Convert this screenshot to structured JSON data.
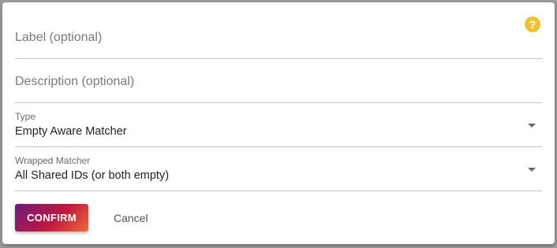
{
  "dialog": {
    "help_icon": "?",
    "label_field": {
      "placeholder": "Label (optional)",
      "value": ""
    },
    "description_field": {
      "placeholder": "Description (optional)",
      "value": ""
    },
    "type_select": {
      "label": "Type",
      "value": "Empty Aware Matcher"
    },
    "wrapped_select": {
      "label": "Wrapped Matcher",
      "value": "All Shared IDs (or both empty)"
    },
    "confirm_label": "CONFIRM",
    "cancel_label": "Cancel"
  },
  "colors": {
    "help_icon": "#f2c12e",
    "confirm_gradient_start": "#6d1a7a",
    "confirm_gradient_end": "#ee6a3c"
  }
}
